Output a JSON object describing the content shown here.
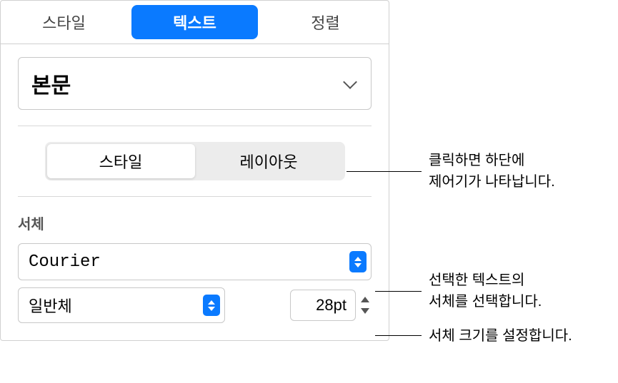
{
  "tabs": {
    "style": "스타일",
    "text": "텍스트",
    "align": "정렬"
  },
  "paragraph_style": {
    "selected": "본문"
  },
  "segmented": {
    "style": "스타일",
    "layout": "레이아웃"
  },
  "font": {
    "section_label": "서체",
    "family": "Courier",
    "weight": "일반체",
    "size": "28pt"
  },
  "callouts": {
    "layout_hint": "클릭하면 하단에\n제어기가 나타납니다.",
    "font_hint": "선택한 텍스트의\n서체를 선택합니다.",
    "size_hint": "서체 크기를 설정합니다."
  }
}
